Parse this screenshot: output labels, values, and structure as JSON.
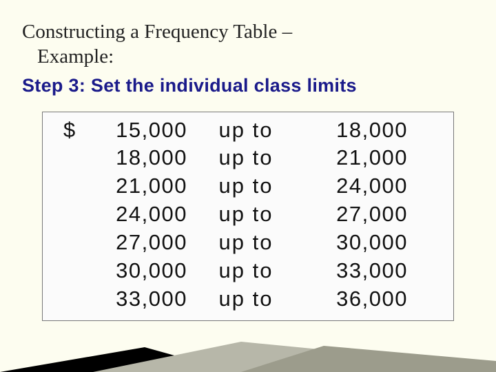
{
  "title_line1": "Constructing a Frequency Table –",
  "title_line2": "Example:",
  "step_label": "Step 3: Set the individual class limits",
  "currency_prefix": "$",
  "connector": "up to",
  "class_limits": [
    {
      "low": "15,000",
      "high": "18,000",
      "show_prefix": true
    },
    {
      "low": "18,000",
      "high": "21,000",
      "show_prefix": false
    },
    {
      "low": "21,000",
      "high": "24,000",
      "show_prefix": false
    },
    {
      "low": "24,000",
      "high": "27,000",
      "show_prefix": false
    },
    {
      "low": "27,000",
      "high": "30,000",
      "show_prefix": false
    },
    {
      "low": "30,000",
      "high": "33,000",
      "show_prefix": false
    },
    {
      "low": "33,000",
      "high": "36,000",
      "show_prefix": false
    }
  ]
}
